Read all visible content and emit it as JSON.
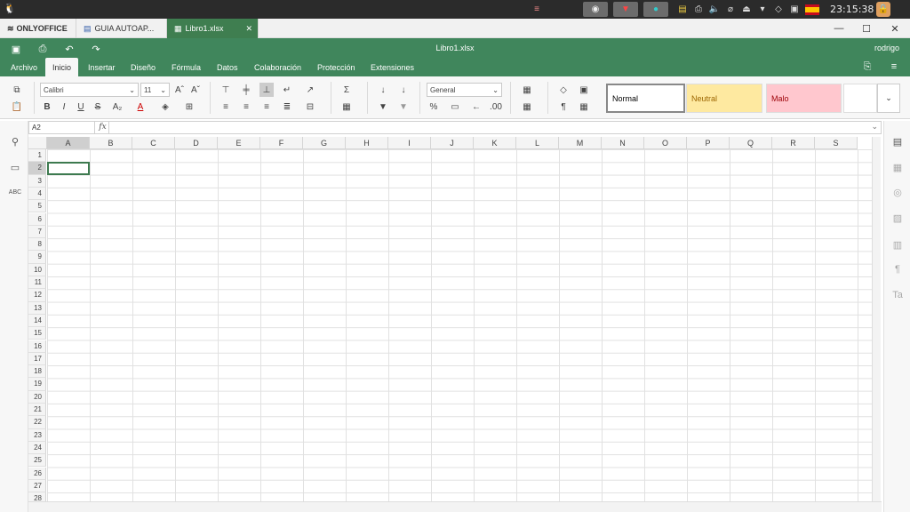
{
  "system": {
    "clock": "23:15:38",
    "tray_icons": [
      "stack-icon",
      "browser-icon",
      "radio-icon",
      "notes-icon",
      "printer-icon",
      "volume-icon",
      "clip-icon",
      "eject-icon",
      "wifi-icon",
      "package-icon",
      "shield-icon",
      "flag-es-icon",
      "lock-icon"
    ]
  },
  "tabs": {
    "app": "ONLYOFFICE",
    "doc1": "GUIA AUTOAP...",
    "doc2": "Libro1.xlsx"
  },
  "header": {
    "title": "Libro1.xlsx",
    "user": "rodrigo"
  },
  "menu": {
    "items": [
      "Archivo",
      "Inicio",
      "Insertar",
      "Diseño",
      "Fórmula",
      "Datos",
      "Colaboración",
      "Protección",
      "Extensiones"
    ],
    "active": "Inicio"
  },
  "toolbar": {
    "font_name": "Calibri",
    "font_size": "11",
    "number_format": "General",
    "styles": {
      "normal": "Normal",
      "neutral": "Neutral",
      "bad": "Malo"
    },
    "colors": {
      "accent": "#40865c",
      "neutral_bg": "#fee9a0",
      "neutral_fg": "#9c6500",
      "bad_bg": "#ffc7ce",
      "bad_fg": "#9c0006"
    }
  },
  "formula_bar": {
    "name_box": "A2",
    "fx": "fx",
    "content": ""
  },
  "sheet": {
    "columns": [
      "A",
      "B",
      "C",
      "D",
      "E",
      "F",
      "G",
      "H",
      "I",
      "J",
      "K",
      "L",
      "M",
      "N",
      "O",
      "P",
      "Q",
      "R",
      "S"
    ],
    "rows": [
      "1",
      "2",
      "3",
      "4",
      "5",
      "6",
      "7",
      "8",
      "9",
      "10",
      "11",
      "12",
      "13",
      "14",
      "15",
      "16",
      "17",
      "18",
      "19",
      "20",
      "21",
      "22",
      "23",
      "24",
      "25",
      "26",
      "27",
      "28"
    ],
    "selected_cell": "A2"
  }
}
